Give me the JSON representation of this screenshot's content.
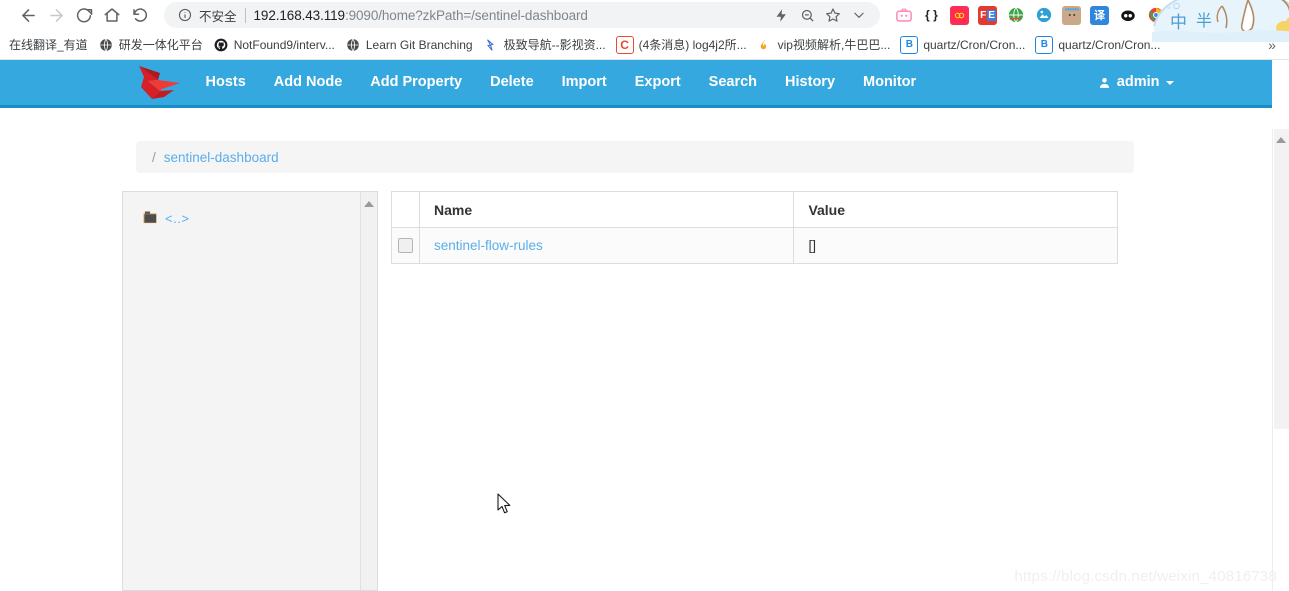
{
  "browser": {
    "nav_buttons": [
      {
        "name": "back",
        "icon": "arrow-left-icon",
        "enabled": true
      },
      {
        "name": "forward",
        "icon": "arrow-right-icon",
        "enabled": false
      },
      {
        "name": "reload",
        "icon": "reload-icon",
        "enabled": true
      },
      {
        "name": "home",
        "icon": "home-icon",
        "enabled": true
      },
      {
        "name": "history-back-dropdown",
        "icon": "undo-icon",
        "enabled": true
      }
    ],
    "omnibox": {
      "security_icon": "info-circle-icon",
      "security_label": "不安全",
      "url_display": "192.168.43.119:9090/home?zkPath=/sentinel-dashboard",
      "url_host": "192.168.43.119",
      "url_path": ":9090/home?zkPath=/sentinel-dashboard",
      "actions": [
        {
          "name": "lightning-icon"
        },
        {
          "name": "zoom-out-icon"
        },
        {
          "name": "bookmark-star-icon"
        },
        {
          "name": "chevron-down-icon"
        }
      ]
    },
    "extensions": [
      {
        "name": "tv-extension",
        "glyph": "📺",
        "color": "#ffffff"
      },
      {
        "name": "json-formatter-extension",
        "glyph": "{ }",
        "color": "#ffffff"
      },
      {
        "name": "infinity-extension",
        "glyph": "∞",
        "color": "#ff2d55"
      },
      {
        "name": "fe-helper-extension",
        "glyph": "FE",
        "color": "#e23b2e"
      },
      {
        "name": "globe-extension",
        "glyph": "🌐",
        "color": "#ffffff"
      },
      {
        "name": "image-extension",
        "glyph": "◕",
        "color": "#2e9ad0"
      },
      {
        "name": "robot-extension",
        "glyph": "▣",
        "color": "#c9a989"
      },
      {
        "name": "translate-extension",
        "glyph": "译",
        "color": "#2e86de"
      },
      {
        "name": "panda-extension",
        "glyph": "●●",
        "color": "#111111"
      },
      {
        "name": "chrome-extension",
        "glyph": "◎",
        "color": "#ea4335"
      }
    ],
    "menu_icon": "kebab-menu-icon",
    "bookmarks": [
      {
        "label": "在线翻译_有道",
        "icon_glyph": "",
        "icon_color": "transparent"
      },
      {
        "label": "研发一体化平台",
        "icon_glyph": "◍",
        "icon_color": "#4a4a4a"
      },
      {
        "label": "NotFound9/interv...",
        "icon_glyph": "",
        "icon_color": "#1b1f23"
      },
      {
        "label": "Learn Git Branching",
        "icon_glyph": "◍",
        "icon_color": "#4a4a4a"
      },
      {
        "label": "极致导航--影视资...",
        "icon_glyph": "☇",
        "icon_color": "#3c6fd1"
      },
      {
        "label": "(4条消息) log4j2所...",
        "icon_glyph": "C",
        "icon_color": "#e8492f"
      },
      {
        "label": "vip视频解析,牛巴巴...",
        "icon_glyph": "🔥",
        "icon_color": "#f5a623"
      },
      {
        "label": "quartz/Cron/Cron...",
        "icon_glyph": "B",
        "icon_color": "#1e88e5"
      },
      {
        "label": "quartz/Cron/Cron...",
        "icon_glyph": "B",
        "icon_color": "#1e88e5"
      }
    ],
    "bookmarks_overflow": "»"
  },
  "ime_widget": {
    "mode_label": "中",
    "width_label": "半",
    "decoration": "duck-bath-skin"
  },
  "app": {
    "logo": "red-bird-logo",
    "nav_items": [
      {
        "label": "Hosts"
      },
      {
        "label": "Add Node"
      },
      {
        "label": "Add Property"
      },
      {
        "label": "Delete"
      },
      {
        "label": "Import"
      },
      {
        "label": "Export"
      },
      {
        "label": "Search"
      },
      {
        "label": "History"
      },
      {
        "label": "Monitor"
      }
    ],
    "user": {
      "icon": "user-icon",
      "label": "admin",
      "caret": "chevron-down-icon"
    },
    "breadcrumb": {
      "separator": "/",
      "path_label": "sentinel-dashboard"
    },
    "tree": {
      "items": [
        {
          "icon": "folder-icon",
          "label": "<..>"
        }
      ]
    },
    "table": {
      "columns": [
        "",
        "Name",
        "Value"
      ],
      "rows": [
        {
          "checked": false,
          "name": "sentinel-flow-rules",
          "value": "[]"
        }
      ]
    },
    "watermark": "https://blog.csdn.net/weixin_40816738",
    "colors": {
      "navbar": "#35a8e0",
      "navbar_border": "#1b8dc6",
      "link": "#5aaeea",
      "logo": "#d62027"
    }
  }
}
